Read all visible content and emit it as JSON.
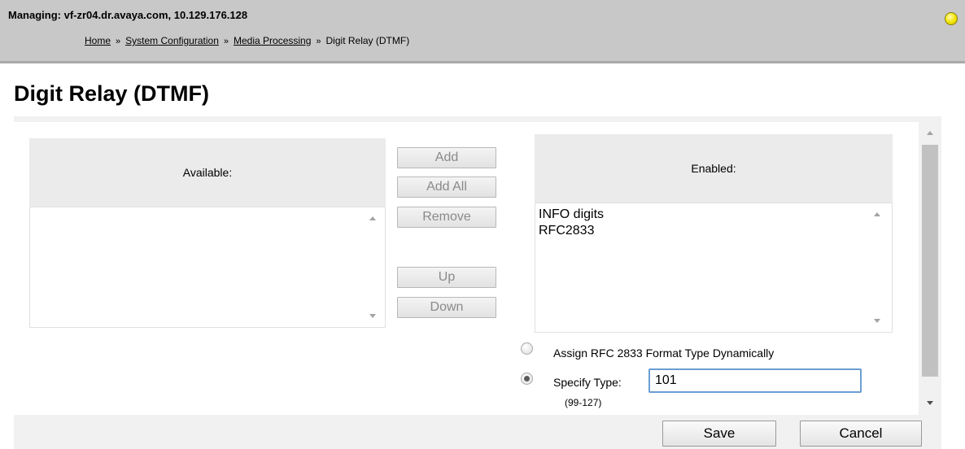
{
  "header": {
    "managing": "Managing: vf-zr04.dr.avaya.com, 10.129.176.128",
    "breadcrumb": {
      "home": "Home",
      "system_configuration": "System Configuration",
      "media_processing": "Media Processing",
      "separator": "»",
      "current": "Digit Relay (DTMF)"
    },
    "status_color": "#f3e400"
  },
  "page": {
    "title": "Digit Relay (DTMF)"
  },
  "available": {
    "header": "Available:",
    "items": []
  },
  "enabled": {
    "header": "Enabled:",
    "items": [
      "INFO digits",
      "RFC2833"
    ]
  },
  "buttons": {
    "add": "Add",
    "add_all": "Add All",
    "remove": "Remove",
    "up": "Up",
    "down": "Down"
  },
  "format_type": {
    "dynamic_label": "Assign RFC 2833 Format Type Dynamically",
    "specify_label": "Specify Type:",
    "specify_value": "101",
    "selected": "specify",
    "range": "(99-127)"
  },
  "footer": {
    "save": "Save",
    "cancel": "Cancel"
  }
}
